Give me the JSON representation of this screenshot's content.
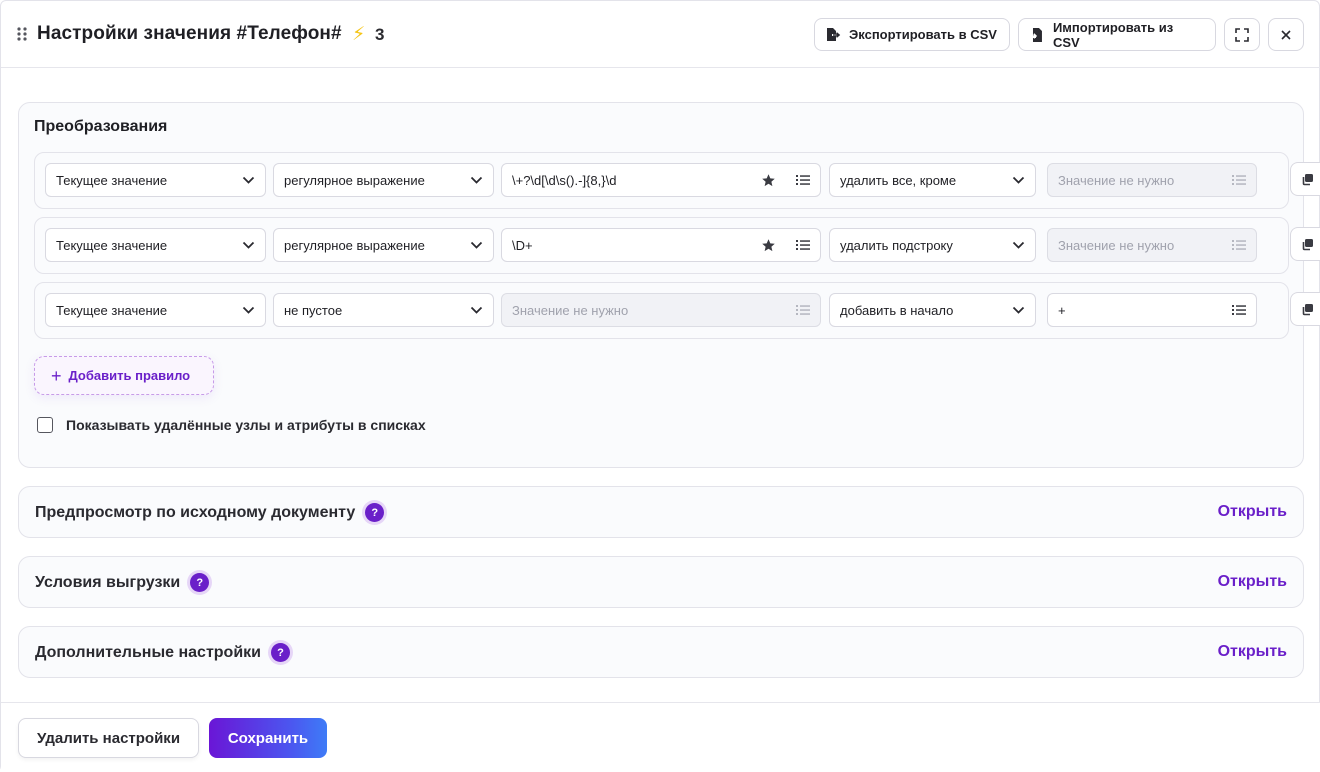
{
  "header": {
    "title": "Настройки значения #Телефон#",
    "count": "3",
    "export_label": "Экспортировать в CSV",
    "import_label": "Импортировать из CSV"
  },
  "transformations": {
    "title": "Преобразования",
    "rules": [
      {
        "source": "Текущее значение",
        "condition": "регулярное выражение",
        "pattern": "\\+?\\d[\\d\\s().-]{8,}\\d",
        "pattern_disabled": false,
        "action": "удалить все, кроме",
        "value": "",
        "value_placeholder": "Значение не нужно",
        "value_disabled": true
      },
      {
        "source": "Текущее значение",
        "condition": "регулярное выражение",
        "pattern": "\\D+",
        "pattern_disabled": false,
        "action": "удалить подстроку",
        "value": "",
        "value_placeholder": "Значение не нужно",
        "value_disabled": true
      },
      {
        "source": "Текущее значение",
        "condition": "не пустое",
        "pattern": "",
        "pattern_placeholder": "Значение не нужно",
        "pattern_disabled": true,
        "action": "добавить в начало",
        "value": "+",
        "value_disabled": false
      }
    ],
    "add_rule_label": "Добавить правило",
    "show_deleted_label": "Показывать удалённые узлы и атрибуты в списках",
    "show_deleted_checked": false
  },
  "panels": [
    {
      "title": "Предпросмотр по исходному документу",
      "open_label": "Открыть"
    },
    {
      "title": "Условия выгрузки",
      "open_label": "Открыть"
    },
    {
      "title": "Дополнительные настройки",
      "open_label": "Открыть"
    }
  ],
  "footer": {
    "delete_label": "Удалить настройки",
    "save_label": "Сохранить"
  },
  "colors": {
    "accent": "#6a1fc9",
    "bolt": "#f5c518",
    "save_gradient_start": "#6a16d6",
    "save_gradient_end": "#3e7cf7"
  },
  "icons": {
    "drag": "drag-handle-icon",
    "bolt": "lightning-icon",
    "export": "file-export-icon",
    "import": "file-import-icon",
    "fullscreen": "fullscreen-icon",
    "close": "close-icon",
    "chevron": "chevron-down-icon",
    "star": "star-icon",
    "list": "list-icon",
    "copy": "copy-icon",
    "plus": "plus-icon",
    "help": "help-icon"
  }
}
